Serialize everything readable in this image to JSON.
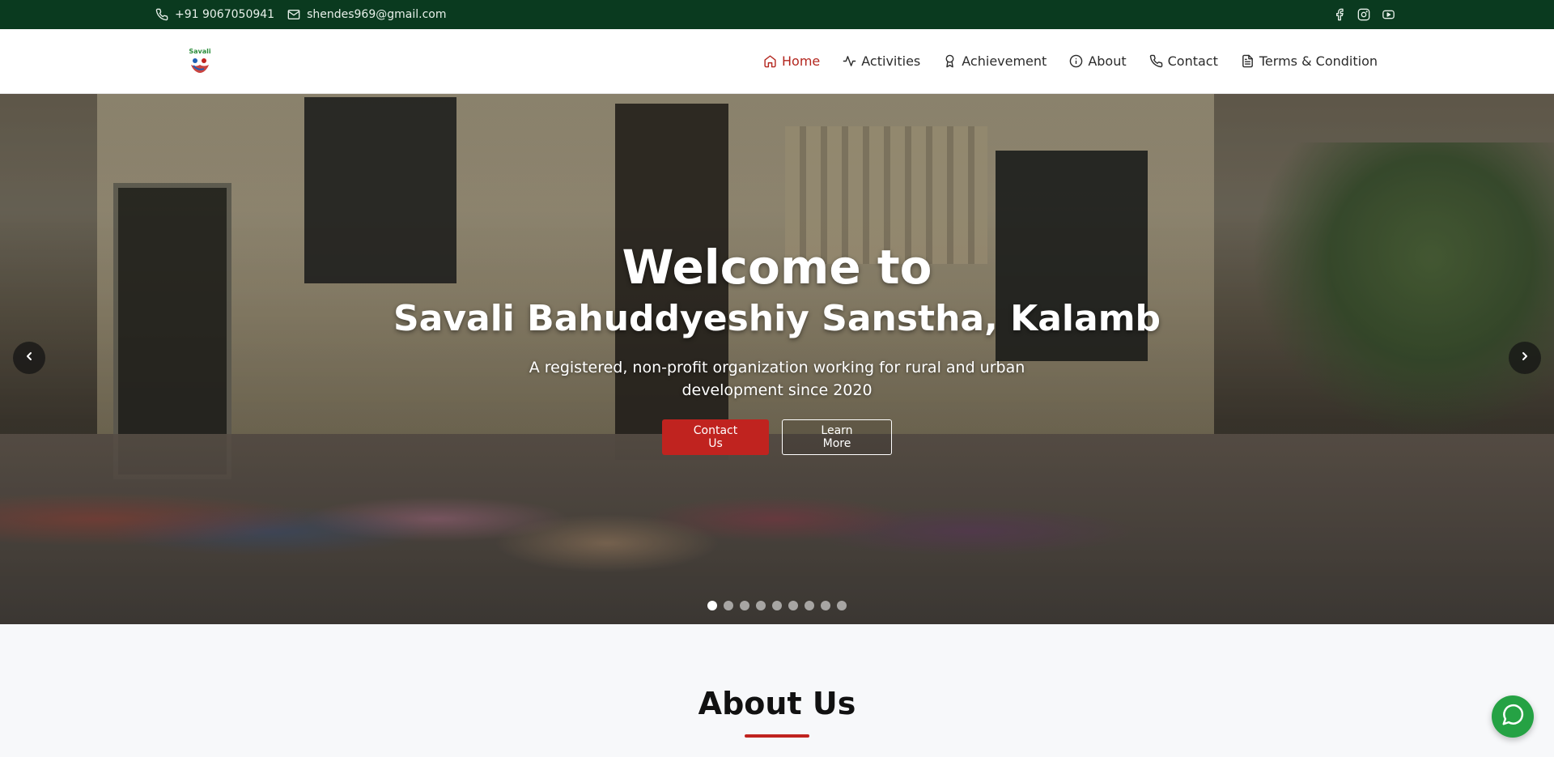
{
  "topbar": {
    "phone": "+91 9067050941",
    "email": "shendes969@gmail.com",
    "socials": [
      "facebook-icon",
      "instagram-icon",
      "youtube-icon"
    ],
    "background": "#0a3a1f"
  },
  "navbar": {
    "logo_text": "Savali",
    "links": [
      {
        "label": "Home",
        "icon": "home-icon",
        "active": true
      },
      {
        "label": "Activities",
        "icon": "activity-icon",
        "active": false
      },
      {
        "label": "Achievement",
        "icon": "award-icon",
        "active": false
      },
      {
        "label": "About",
        "icon": "info-icon",
        "active": false
      },
      {
        "label": "Contact",
        "icon": "phone-icon",
        "active": false
      },
      {
        "label": "Terms & Condition",
        "icon": "document-icon",
        "active": false
      }
    ],
    "active_color": "#b3261e"
  },
  "hero": {
    "title": "Welcome to",
    "subtitle": "Savali Bahuddyeshiy Sanstha, Kalamb",
    "description": "A registered, non-profit organization working for rural and urban development since 2020",
    "primary_button": "Contact Us",
    "secondary_button": "Learn More",
    "slide_count": 9,
    "active_slide": 1,
    "accent_color": "#c0231f"
  },
  "about": {
    "title": "About Us"
  },
  "whatsapp": {
    "icon": "whatsapp-icon",
    "color": "#25a244"
  }
}
